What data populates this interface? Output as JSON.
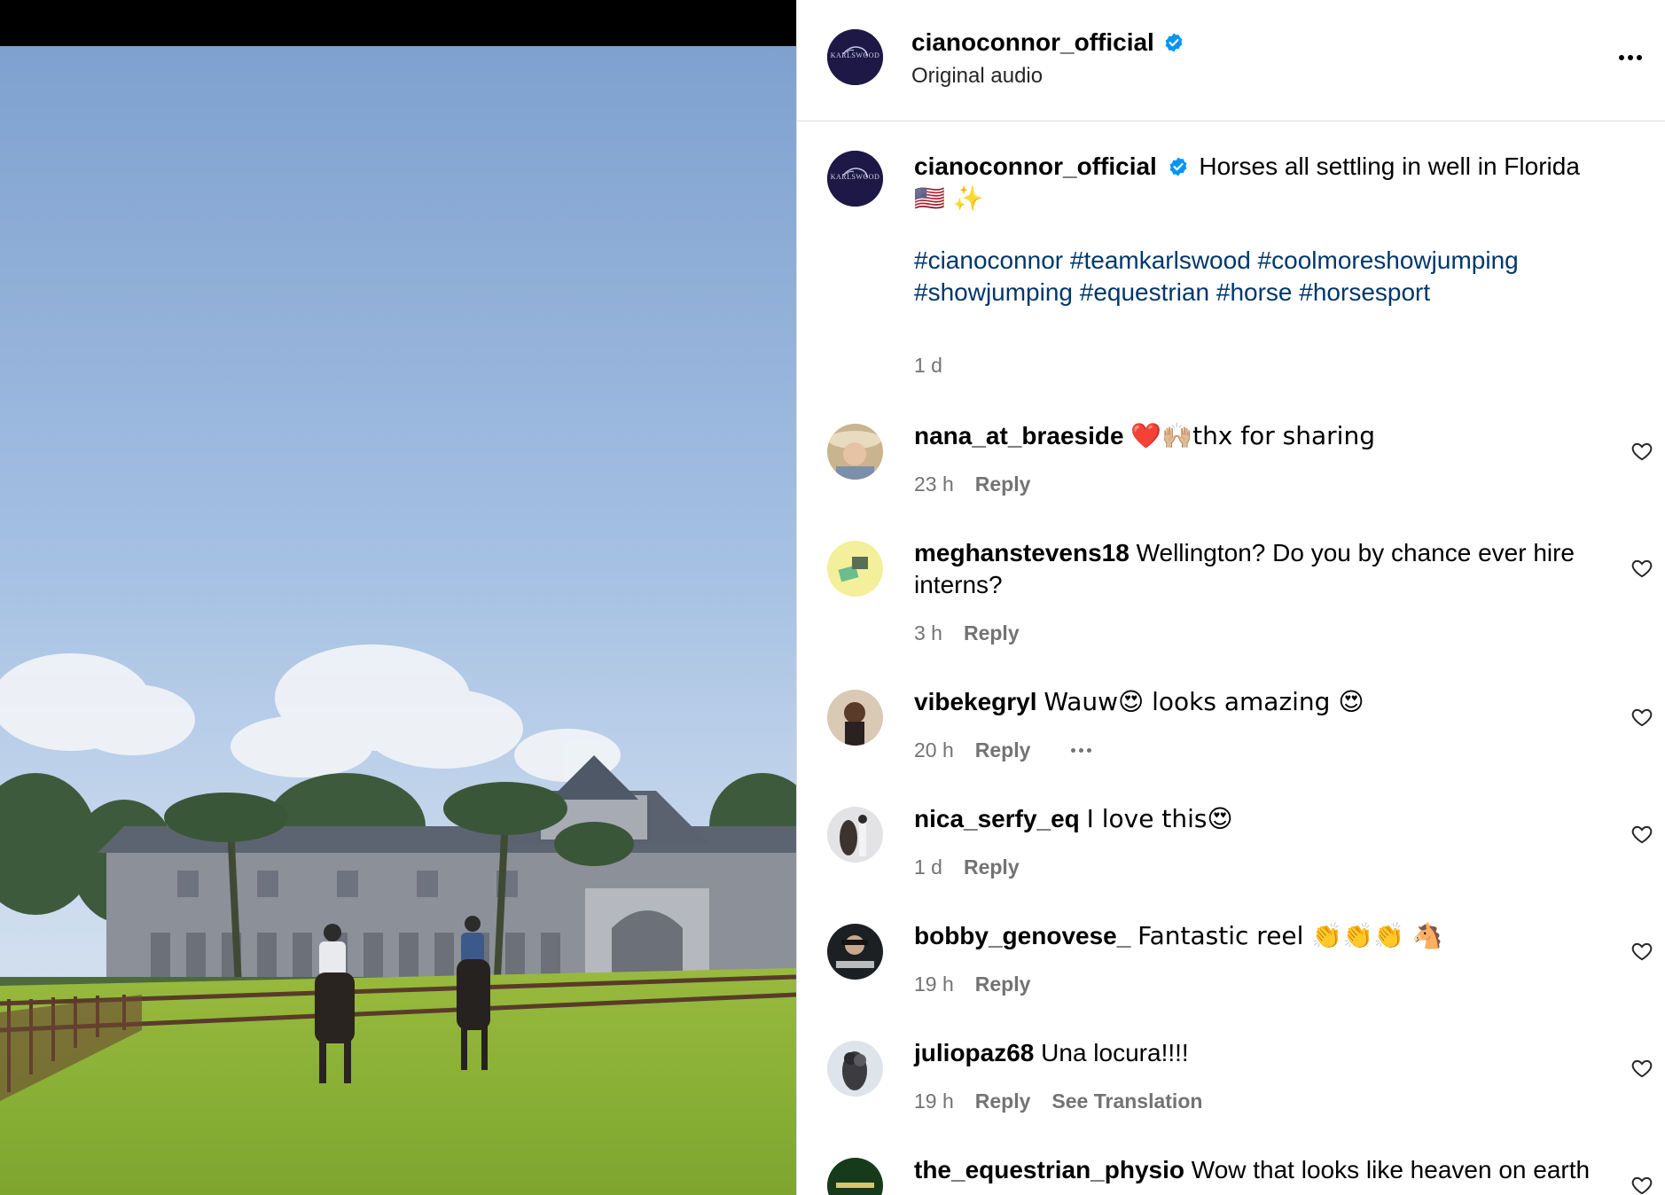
{
  "post": {
    "username": "cianoconnor_official",
    "subtitle": "Original audio",
    "avatar_logo_text": "KARLSWOOD",
    "caption_text": "Horses all settling in well in Florida",
    "caption_emoji": "🇺🇸 ✨",
    "hashtags": "#cianoconnor #teamkarlswood #coolmoreshowjumping #showjumping #equestrian #horse #horsesport",
    "time": "1 d"
  },
  "comments": [
    {
      "username": "nana_at_braeside",
      "text": "❤️🙌🏼thx for sharing",
      "time": "23 h",
      "reply": "Reply"
    },
    {
      "username": "meghanstevens18",
      "text": "Wellington? Do you by chance ever hire interns?",
      "time": "3 h",
      "reply": "Reply"
    },
    {
      "username": "vibekegryl",
      "text": "Wauw😍 looks amazing 😍",
      "time": "20 h",
      "reply": "Reply"
    },
    {
      "username": "nica_serfy_eq",
      "text": "I love this😍",
      "time": "1 d",
      "reply": "Reply"
    },
    {
      "username": "bobby_genovese_",
      "text": "Fantastic reel 👏👏👏 🐴",
      "time": "19 h",
      "reply": "Reply"
    },
    {
      "username": "juliopaz68",
      "text": "Una locura!!!!",
      "time": "19 h",
      "reply": "Reply",
      "translate": "See Translation"
    },
    {
      "username": "the_equestrian_physio",
      "text": "Wow that looks like heaven on earth",
      "time": "",
      "reply": ""
    }
  ],
  "colors": {
    "link": "#00376b",
    "secondary_text": "#737373",
    "verified": "#0095f6",
    "divider": "#dbdbdb"
  },
  "icons": {
    "verified": "verified-badge-icon",
    "more": "more-options-icon",
    "like": "heart-icon"
  }
}
